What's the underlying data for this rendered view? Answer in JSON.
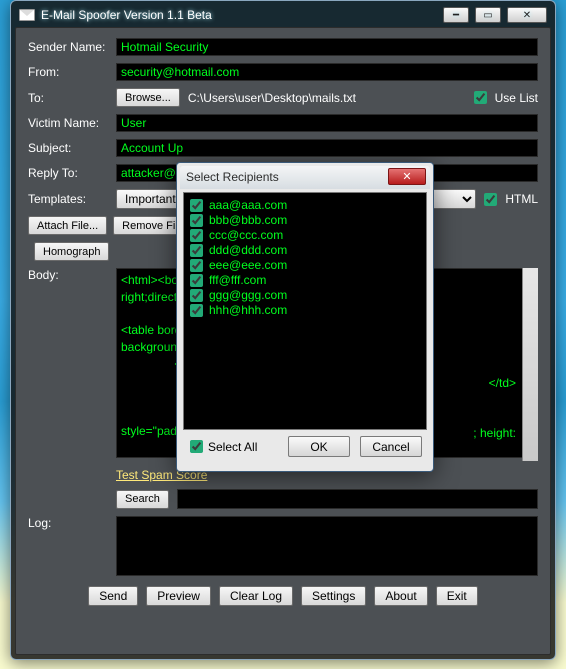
{
  "window": {
    "title": "E-Mail Spoofer Version 1.1 Beta"
  },
  "labels": {
    "sender_name": "Sender Name:",
    "from": "From:",
    "to": "To:",
    "victim_name": "Victim Name:",
    "subject": "Subject:",
    "reply_to": "Reply To:",
    "templates": "Templates:",
    "body": "Body:",
    "log": "Log:"
  },
  "fields": {
    "sender_name": "Hotmail Security",
    "from": "security@hotmail.com",
    "to_path": "C:\\Users\\user\\Desktop\\mails.txt",
    "victim_name": "User",
    "subject": "Account Up",
    "reply_to": "attacker@g",
    "templates_selected": "Important up",
    "body": "<html><body\nright;directio\n\n<table border\nbackground-\n                <t\n\n\n\nstyle=\"paddi\n\n85px; width:\n\nborder=\"0\" c                                                                                            letter\"",
    "body_tail_1": "</td>",
    "body_tail_2": "; height:",
    "log": ""
  },
  "buttons": {
    "browse": "Browse...",
    "attach_file": "Attach File...",
    "remove_file": "Remove File",
    "homograph": "Homograph",
    "test_spam": "Test Spam Score",
    "search": "Search",
    "send": "Send",
    "preview": "Preview",
    "clear_log": "Clear Log",
    "settings": "Settings",
    "about": "About",
    "exit": "Exit"
  },
  "checks": {
    "use_list": "Use List",
    "html": "HTML"
  },
  "modal": {
    "title": "Select Recipients",
    "select_all": "Select All",
    "ok": "OK",
    "cancel": "Cancel",
    "recipients": [
      {
        "email": "aaa@aaa.com",
        "checked": true
      },
      {
        "email": "bbb@bbb.com",
        "checked": true
      },
      {
        "email": "ccc@ccc.com",
        "checked": true
      },
      {
        "email": "ddd@ddd.com",
        "checked": true
      },
      {
        "email": "eee@eee.com",
        "checked": true
      },
      {
        "email": "fff@fff.com",
        "checked": true
      },
      {
        "email": "ggg@ggg.com",
        "checked": true
      },
      {
        "email": "hhh@hhh.com",
        "checked": true
      }
    ]
  }
}
